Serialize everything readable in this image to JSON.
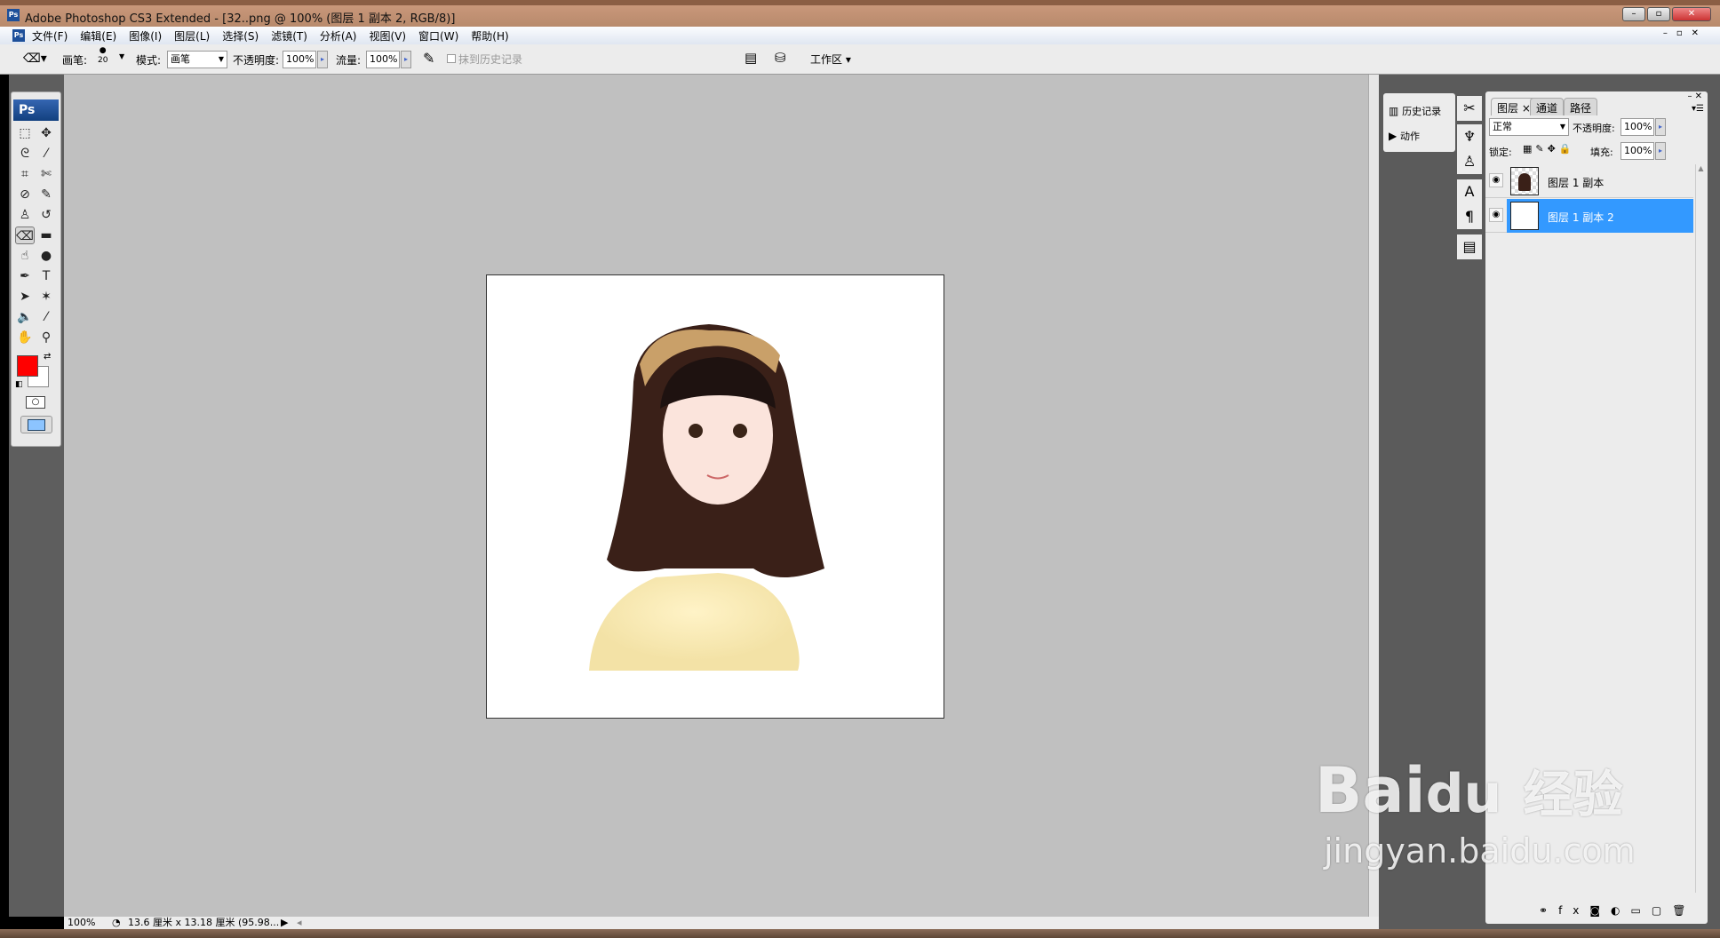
{
  "window": {
    "title": "Adobe Photoshop CS3 Extended - [32..png @ 100% (图层 1 副本 2, RGB/8)]",
    "app_icon": "Ps"
  },
  "menu": [
    "文件(F)",
    "编辑(E)",
    "图像(I)",
    "图层(L)",
    "选择(S)",
    "滤镜(T)",
    "分析(A)",
    "视图(V)",
    "窗口(W)",
    "帮助(H)"
  ],
  "options": {
    "brush_label": "画笔:",
    "brush_size": "20",
    "mode_label": "模式:",
    "mode_value": "画笔",
    "opacity_label": "不透明度:",
    "opacity_value": "100%",
    "flow_label": "流量:",
    "flow_value": "100%",
    "erase_history_label": "抹到历史记录",
    "workspace_label": "工作区"
  },
  "toolbox": {
    "logo": "Ps",
    "foreground_color": "#ff0000",
    "background_color": "#ffffff"
  },
  "history_panel": {
    "items": [
      "历史记录",
      "动作"
    ]
  },
  "layers_panel": {
    "tabs": [
      "图层",
      "通道",
      "路径"
    ],
    "blend_mode": "正常",
    "opacity_label": "不透明度:",
    "opacity_value": "100%",
    "lock_label": "锁定:",
    "fill_label": "填充:",
    "fill_value": "100%",
    "layers": [
      {
        "name": "图层 1 副本",
        "selected": false
      },
      {
        "name": "图层 1 副本 2",
        "selected": true
      }
    ]
  },
  "status": {
    "zoom": "100%",
    "doc_info": "13.6 厘米 x 13.18 厘米 (95.98..."
  },
  "colors": {
    "selection": "#3399ff",
    "canvas_bg": "#c0c0c0"
  },
  "watermark": {
    "line1": "Bai du 经验",
    "line2": "jingyan.baidu.com"
  }
}
